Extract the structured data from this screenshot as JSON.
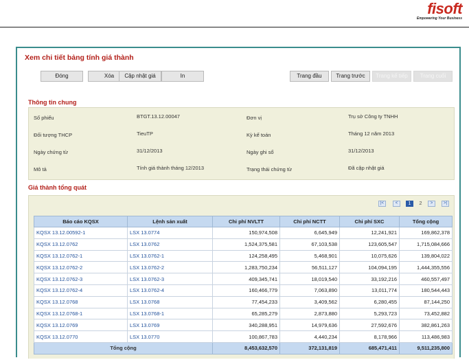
{
  "brand": {
    "name": "fisoft",
    "tagline": "Empowering Your Business",
    "color": "#c8281e"
  },
  "page_title": "Xem chi tiết bảng tính giá thành",
  "toolbar": {
    "left": [
      "Đóng",
      "Xóa",
      "Cập nhật giá",
      "In"
    ],
    "right": [
      "Trang đầu",
      "Trang trước",
      "Trang kế tiếp",
      "Trang cuối"
    ]
  },
  "general_info": {
    "title": "Thông tin chung",
    "rows": [
      {
        "label1": "Số phiếu",
        "value1": "BTGT.13.12.00047",
        "label2": "Đơn vị",
        "value2": "Trụ sở Công ty TNHH"
      },
      {
        "label1": "Đối tượng THCP",
        "value1": "TieuTP",
        "label2": "Kỳ kế toán",
        "value2": "Tháng 12 năm 2013"
      },
      {
        "label1": "Ngày chứng từ",
        "value1": "31/12/2013",
        "label2": "Ngày ghi sổ",
        "value2": "31/12/2013"
      },
      {
        "label1": "Mô tả",
        "value1": "Tính giá thành tháng 12/2013",
        "label2": "Trạng thái chứng từ",
        "value2": "Đã cập nhật giá"
      }
    ]
  },
  "cost_section": {
    "title": "Giá thành tổng quát",
    "pager": {
      "pages": [
        "1",
        "2"
      ],
      "current": "1"
    },
    "columns": [
      "Báo cáo KQSX",
      "Lệnh sản xuất",
      "Chi phí NVLTT",
      "Chi phí NCTT",
      "Chi phí SXC",
      "Tổng cộng"
    ],
    "rows": [
      [
        "KQSX 13.12.00592-1",
        "LSX 13.0774",
        "150,974,508",
        "6,645,949",
        "12,241,921",
        "169,862,378"
      ],
      [
        "KQSX 13.12.0762",
        "LSX 13.0762",
        "1,524,375,581",
        "67,103,538",
        "123,605,547",
        "1,715,084,666"
      ],
      [
        "KQSX 13.12.0762-1",
        "LSX 13.0762-1",
        "124,258,495",
        "5,468,901",
        "10,075,626",
        "139,804,022"
      ],
      [
        "KQSX 13.12.0762-2",
        "LSX 13.0762-2",
        "1,283,750,234",
        "56,511,127",
        "104,094,195",
        "1,444,355,556"
      ],
      [
        "KQSX 13.12.0762-3",
        "LSX 13.0762-3",
        "409,345,741",
        "18,019,540",
        "33,192,216",
        "460,557,497"
      ],
      [
        "KQSX 13.12.0762-4",
        "LSX 13.0762-4",
        "160,466,779",
        "7,063,890",
        "13,011,774",
        "180,544,443"
      ],
      [
        "KQSX 13.12.0768",
        "LSX 13.0768",
        "77,454,233",
        "3,409,562",
        "6,280,455",
        "87,144,250"
      ],
      [
        "KQSX 13.12.0768-1",
        "LSX 13.0768-1",
        "65,285,279",
        "2,873,880",
        "5,293,723",
        "73,452,882"
      ],
      [
        "KQSX 13.12.0769",
        "LSX 13.0769",
        "340,288,951",
        "14,979,636",
        "27,592,676",
        "382,861,263"
      ],
      [
        "KQSX 13.12.0770",
        "LSX 13.0770",
        "100,867,783",
        "4,440,234",
        "8,178,966",
        "113,486,983"
      ]
    ],
    "total": {
      "label": "Tổng cộng",
      "nvltt": "8,453,632,570",
      "nctt": "372,131,819",
      "sxc": "685,471,411",
      "tong": "9,511,235,800"
    }
  }
}
